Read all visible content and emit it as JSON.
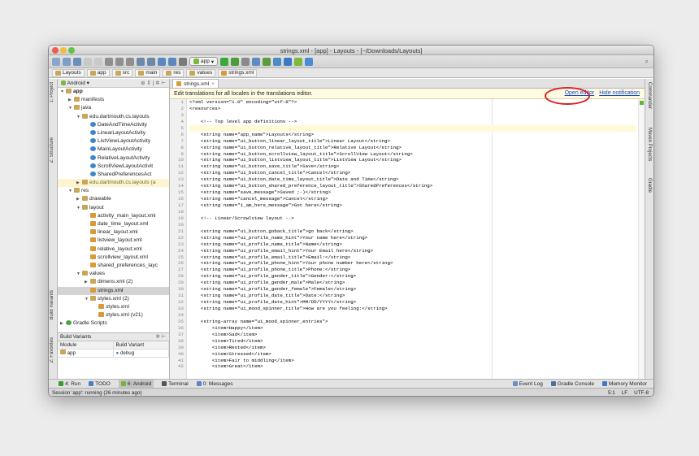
{
  "window_title": "strings.xml - [app] - Layouts - [~/Downloads/Layouts]",
  "toolbar": {
    "run_config": "app"
  },
  "navbar": [
    "Layouts",
    "app",
    "src",
    "main",
    "res",
    "values",
    "strings.xml"
  ],
  "left_tabs": [
    "1: Project",
    "Z: Structure",
    "Build Variants",
    "2: Favorites"
  ],
  "right_tabs": [
    "Commander",
    "Maven Projects",
    "Gradle"
  ],
  "project_panel": {
    "view": "Android"
  },
  "tree": [
    {
      "indent": 0,
      "arrow": "▼",
      "icon": "folder",
      "label": "app",
      "bold": true
    },
    {
      "indent": 1,
      "arrow": "▶",
      "icon": "folder",
      "label": "manifests"
    },
    {
      "indent": 1,
      "arrow": "▼",
      "icon": "folder",
      "label": "java"
    },
    {
      "indent": 2,
      "arrow": "▼",
      "icon": "package",
      "label": "edu.dartmouth.cs.layouts"
    },
    {
      "indent": 3,
      "arrow": "",
      "icon": "class",
      "label": "DateAndTimeActivity"
    },
    {
      "indent": 3,
      "arrow": "",
      "icon": "class",
      "label": "LinearLayoutActivity"
    },
    {
      "indent": 3,
      "arrow": "",
      "icon": "class",
      "label": "ListViewLayoutActivity"
    },
    {
      "indent": 3,
      "arrow": "",
      "icon": "class",
      "label": "MainLayoutActivity"
    },
    {
      "indent": 3,
      "arrow": "",
      "icon": "class",
      "label": "RelativeLayoutActivity"
    },
    {
      "indent": 3,
      "arrow": "",
      "icon": "class",
      "label": "ScrollViewLayoutActivit"
    },
    {
      "indent": 3,
      "arrow": "",
      "icon": "class",
      "label": "SharedPreferencesAct"
    },
    {
      "indent": 2,
      "arrow": "▶",
      "icon": "package",
      "label": "edu.dartmouth.cs.layouts (a",
      "highlight": true
    },
    {
      "indent": 1,
      "arrow": "▼",
      "icon": "folder",
      "label": "res"
    },
    {
      "indent": 2,
      "arrow": "▶",
      "icon": "folder",
      "label": "drawable"
    },
    {
      "indent": 2,
      "arrow": "▼",
      "icon": "folder",
      "label": "layout"
    },
    {
      "indent": 3,
      "arrow": "",
      "icon": "xml",
      "label": "activity_main_layout.xml"
    },
    {
      "indent": 3,
      "arrow": "",
      "icon": "xml",
      "label": "date_time_layout.xml"
    },
    {
      "indent": 3,
      "arrow": "",
      "icon": "xml",
      "label": "linear_layout.xml"
    },
    {
      "indent": 3,
      "arrow": "",
      "icon": "xml",
      "label": "listview_layout.xml"
    },
    {
      "indent": 3,
      "arrow": "",
      "icon": "xml",
      "label": "relative_layout.xml"
    },
    {
      "indent": 3,
      "arrow": "",
      "icon": "xml",
      "label": "scrollview_layout.xml"
    },
    {
      "indent": 3,
      "arrow": "",
      "icon": "xml",
      "label": "shared_preferences_layc"
    },
    {
      "indent": 2,
      "arrow": "▼",
      "icon": "folder",
      "label": "values"
    },
    {
      "indent": 3,
      "arrow": "▶",
      "icon": "folder",
      "label": "dimens.xml (2)"
    },
    {
      "indent": 3,
      "arrow": "",
      "icon": "xml",
      "label": "strings.xml",
      "selected": true
    },
    {
      "indent": 3,
      "arrow": "▼",
      "icon": "folder",
      "label": "styles.xml (2)"
    },
    {
      "indent": 4,
      "arrow": "",
      "icon": "xml",
      "label": "styles.xml"
    },
    {
      "indent": 4,
      "arrow": "",
      "icon": "xml",
      "label": "styles.xml (v21)"
    },
    {
      "indent": 0,
      "arrow": "▶",
      "icon": "gradle",
      "label": "Gradle Scripts"
    }
  ],
  "build_variants": {
    "title": "Build Variants",
    "col_module": "Module",
    "col_variant": "Build Variant",
    "module": "app",
    "variant": "debug"
  },
  "editor": {
    "tab": "strings.xml",
    "notification": "Edit translations for all locales in the translations editor.",
    "open_editor": "Open editor",
    "hide_notification": "Hide notification"
  },
  "code_lines": [
    "<?xml version=\"1.0\" encoding=\"utf-8\"?>",
    "<resources>",
    "",
    "    <!-- Top level app definitions -->",
    "",
    "    <string name=\"app_name\">Layouts</string>",
    "    <string name=\"ui_button_linear_layout_title\">Linear Layout</string>",
    "    <string name=\"ui_button_relative_layout_title\">Relative Layout</string>",
    "    <string name=\"ui_button_scrollview_layout_title\">ScrollView Layout</string>",
    "    <string name=\"ui_button_listview_layout_title\">ListView Layout</string>",
    "    <string name=\"ui_button_save_title\">Save</string>",
    "    <string name=\"ui_button_cancel_title\">Cancel</string>",
    "    <string name=\"ui_button_date_time_layout_title\">Date and Time</string>",
    "    <string name=\"ui_button_shared_preference_layout_title\">SharedPreferences</string>",
    "    <string name=\"save_message\">Saved ;-)</string>",
    "    <string name=\"cancel_message\">Cancel</string>",
    "    <string name=\"i_am_here_message\">Got here</string>",
    "",
    "    <!-- Linear/Scrowlview layout -->",
    "",
    "    <string name=\"ui_button_goback_title\">go back</string>",
    "    <string name=\"ui_profile_name_hint\">Your name here</string>",
    "    <string name=\"ui_profile_name_title\">Name</string>",
    "    <string name=\"ui_profile_email_hint\">Your Email here</string>",
    "    <string name=\"ui_profile_email_title\">Email:</string>",
    "    <string name=\"ui_profile_phone_hint\">Your phone number here</string>",
    "    <string name=\"ui_profile_phone_title\">Phone:</string>",
    "    <string name=\"ui_profile_gender_title\">Gender:</string>",
    "    <string name=\"ui_profile_gender_male\">Male</string>",
    "    <string name=\"ui_profile_gender_female\">Female</string>",
    "    <string name=\"ui_profile_date_title\">Date:</string>",
    "    <string name=\"ui_profile_date_hint\">MM/DD/YYYY</string>",
    "    <string name=\"ui_mood_spinner_title\">How are you feeling:</string>",
    "",
    "    <string-array name=\"ui_mood_spinner_entries\">",
    "        <item>Happy</item>",
    "        <item>Sad</item>",
    "        <item>Tired</item>",
    "        <item>Rested</item>",
    "        <item>Stressed</item>",
    "        <item>Fair to middling</item>",
    "        <item>Great</item>"
  ],
  "bottom_tabs": [
    {
      "label": "4: Run",
      "color": "#3a9a2e"
    },
    {
      "label": "TODO",
      "color": "#4a7fc0"
    },
    {
      "label": "6: Android",
      "color": "#7ab33a",
      "active": true
    },
    {
      "label": "Terminal",
      "color": "#555555"
    },
    {
      "label": "0: Messages",
      "color": "#5b85c6"
    }
  ],
  "bottom_right_tabs": [
    {
      "label": "Event Log",
      "color": "#6a8fc8"
    },
    {
      "label": "Gradle Console",
      "color": "#4a6f9c"
    },
    {
      "label": "Memory Monitor",
      "color": "#3f7bc0"
    }
  ],
  "status": {
    "message": "Session 'app': running (26 minutes ago)",
    "position": "5:1",
    "line_sep": "LF",
    "encoding": "UTF-8"
  },
  "colors": {
    "accent_red": "#d62020",
    "link": "#1a4ac4",
    "caret_row": "#fffbd8"
  }
}
